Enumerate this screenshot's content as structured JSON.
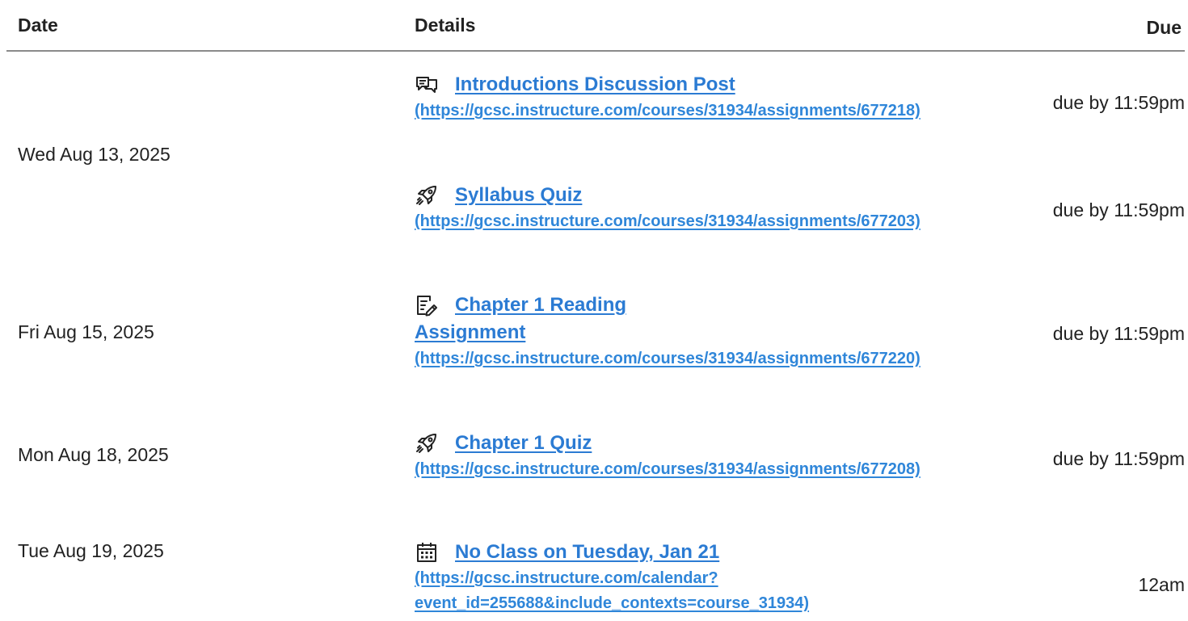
{
  "headers": {
    "date": "Date",
    "details": "Details",
    "due": "Due"
  },
  "colors": {
    "link": "#2b7bd3",
    "text": "#222222",
    "rule": "#8a8a8a"
  },
  "rows": [
    {
      "date": "Wed Aug 13, 2025",
      "items": [
        {
          "icon": "discussion-icon",
          "title": "Introductions Discussion Post",
          "url": "(https://gcsc.instructure.com/courses/31934/assignments/677218)",
          "due": "due by 11:59pm"
        },
        {
          "icon": "quiz-rocket-icon",
          "title": "Syllabus Quiz",
          "url": "(https://gcsc.instructure.com/courses/31934/assignments/677203)",
          "due": "due by 11:59pm"
        }
      ]
    },
    {
      "date": "Fri Aug 15, 2025",
      "items": [
        {
          "icon": "assignment-edit-icon",
          "title_line1": "Chapter 1 Reading",
          "title_line2": "Assignment",
          "url": "(https://gcsc.instructure.com/courses/31934/assignments/677220)",
          "due": "due by 11:59pm"
        }
      ]
    },
    {
      "date": "Mon Aug 18, 2025",
      "items": [
        {
          "icon": "quiz-rocket-icon",
          "title": "Chapter 1 Quiz",
          "url": "(https://gcsc.instructure.com/courses/31934/assignments/677208)",
          "due": "due by 11:59pm"
        }
      ]
    },
    {
      "date": "Tue Aug 19, 2025",
      "items": [
        {
          "icon": "calendar-icon",
          "title": "No Class on Tuesday, Jan 21",
          "url_line1": "(https://gcsc.instructure.com/calendar?",
          "url_line2": "event_id=255688&include_contexts=course_31934)",
          "due": "12am"
        }
      ]
    }
  ]
}
